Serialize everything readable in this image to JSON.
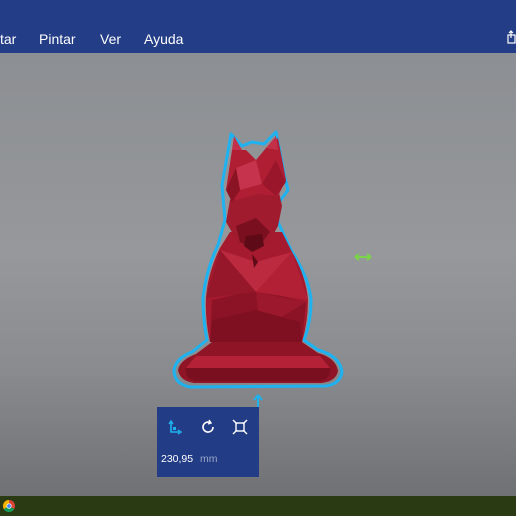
{
  "menu": {
    "items": [
      {
        "label": "tar"
      },
      {
        "label": "Pintar"
      },
      {
        "label": "Ver"
      },
      {
        "label": "Ayuda"
      }
    ]
  },
  "icons": {
    "topbar_right": "share-icon",
    "side_handle": "resize-horizontal-arrow-icon",
    "bottom_handle": "move-up-arrow-icon",
    "taskbar_app": "chrome-icon"
  },
  "panel": {
    "tools": [
      "move-tool-icon",
      "rotate-tool-icon",
      "scale-tool-icon"
    ],
    "value": "230,95",
    "unit": "mm"
  },
  "colors": {
    "accent": "#1fb2f0",
    "model": "#a51a2e",
    "menubar": "#233d86",
    "handle_green": "#7bd34a"
  }
}
